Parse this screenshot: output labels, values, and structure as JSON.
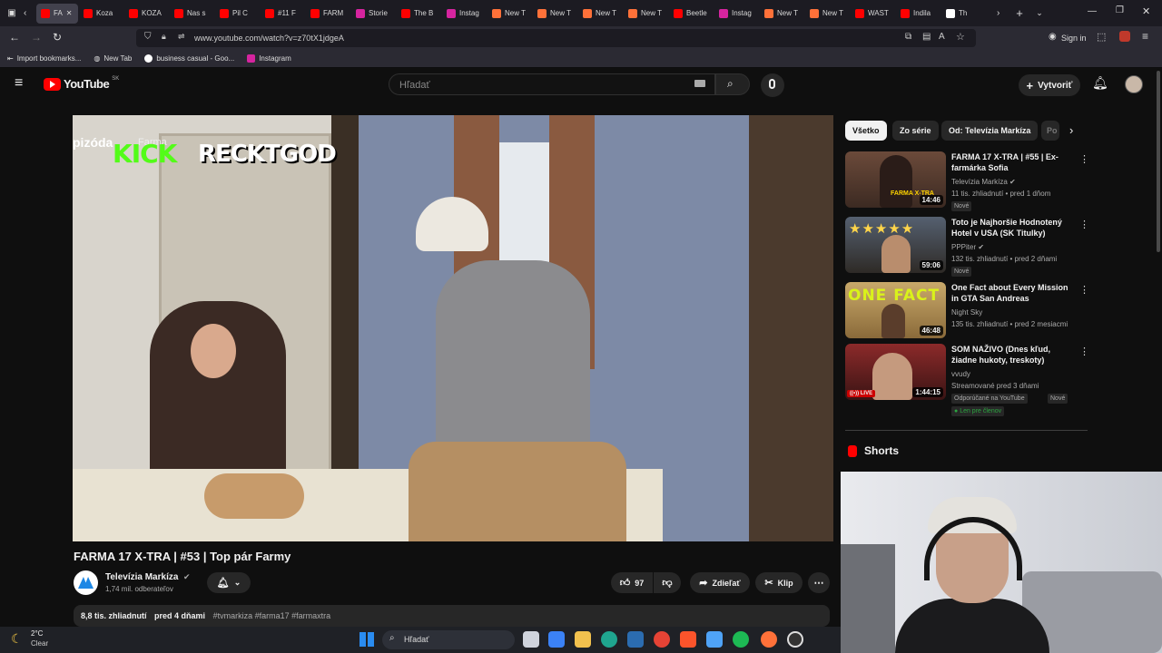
{
  "browser": {
    "tabs": [
      {
        "label": "FA",
        "active": true,
        "color": "#ff0000"
      },
      {
        "label": "Koza",
        "color": "#ff0000"
      },
      {
        "label": "KOZA",
        "color": "#ff0000"
      },
      {
        "label": "Nas s",
        "color": "#ff0000"
      },
      {
        "label": "Pil C",
        "color": "#ff0000"
      },
      {
        "label": "#11 F",
        "color": "#ff0000"
      },
      {
        "label": "FARM",
        "color": "#ff0000"
      },
      {
        "label": "Storie",
        "color": "#d6249f"
      },
      {
        "label": "The B",
        "color": "#ff0000"
      },
      {
        "label": "Instag",
        "color": "#d6249f"
      },
      {
        "label": "New T",
        "color": "#ff7139"
      },
      {
        "label": "New T",
        "color": "#ff7139"
      },
      {
        "label": "New T",
        "color": "#ff7139"
      },
      {
        "label": "New T",
        "color": "#ff7139"
      },
      {
        "label": "Beetle",
        "color": "#ff0000"
      },
      {
        "label": "Instag",
        "color": "#d6249f"
      },
      {
        "label": "New T",
        "color": "#ff7139"
      },
      {
        "label": "New T",
        "color": "#ff7139"
      },
      {
        "label": "WAST",
        "color": "#ff0000"
      },
      {
        "label": "Indila",
        "color": "#ff0000"
      },
      {
        "label": "Th",
        "color": "#ffffff"
      }
    ],
    "url": "www.youtube.com/watch?v=z70tX1jdgeA",
    "sign_in": "Sign in",
    "bookmarks": [
      "Import bookmarks...",
      "New Tab",
      "business casual - Goo...",
      "Instagram"
    ]
  },
  "youtube": {
    "logo": "YouTube",
    "region": "SK",
    "search_placeholder": "Hľadať",
    "create_label": "Vytvoriť"
  },
  "video": {
    "overlay_text": "pizóda",
    "overlay_text2": "Farma",
    "kick_logo": "KICK",
    "streamer_name": "RECKTGOD",
    "title": "FARMA 17 X-TRA | #53 | Top pár Farmy",
    "channel": "Televízia Markíza",
    "subscribers": "1,74 mil. odberateľov",
    "likes": "97",
    "share_label": "Zdieľať",
    "clip_label": "Klip",
    "views": "8,8 tis. zhliadnutí",
    "published": "pred 4 dňami",
    "hashtags": "#tvmarkiza #farma17 #farmaxtra"
  },
  "chips": [
    "Všetko",
    "Zo série",
    "Od: Televízia Markíza",
    "Po"
  ],
  "recommendations": [
    {
      "title": "FARMA 17 X-TRA | #55 | Ex-farmárka Sofia",
      "channel": "Televízia Markíza",
      "verified": true,
      "meta": "11 tis. zhliadnutí • pred 1 dňom",
      "badges": [
        "Nové"
      ],
      "duration": "14:46",
      "thumb_text": "FARMA X-TRA"
    },
    {
      "title": "Toto je Najhoršie Hodnotený Hotel v USA (SK Titulky)",
      "channel": "PPPiter",
      "verified": true,
      "meta": "132 tis. zhliadnutí • pred 2 dňami",
      "badges": [
        "Nové"
      ],
      "duration": "59:06",
      "thumb_text": ""
    },
    {
      "title": "One Fact about Every Mission in GTA San Andreas",
      "channel": "Night Sky",
      "verified": false,
      "meta": "135 tis. zhliadnutí • pred 2 mesiacmi",
      "badges": [],
      "duration": "46:48",
      "thumb_text": "ONE FACT"
    },
    {
      "title": "SOM NAŽIVO (Dnes kľud, žiadne hukoty, treskoty)",
      "channel": "vvudy",
      "verified": false,
      "meta": "Streamované pred 3 dňami",
      "badges": [
        "Odporúčané na YouTube",
        "Nové"
      ],
      "members": "Len pre členov",
      "duration": "1:44:15",
      "live": "LIVE"
    }
  ],
  "shorts_label": "Shorts",
  "taskbar": {
    "weather_temp": "2°C",
    "weather_desc": "Clear",
    "search": "Hľadať"
  }
}
